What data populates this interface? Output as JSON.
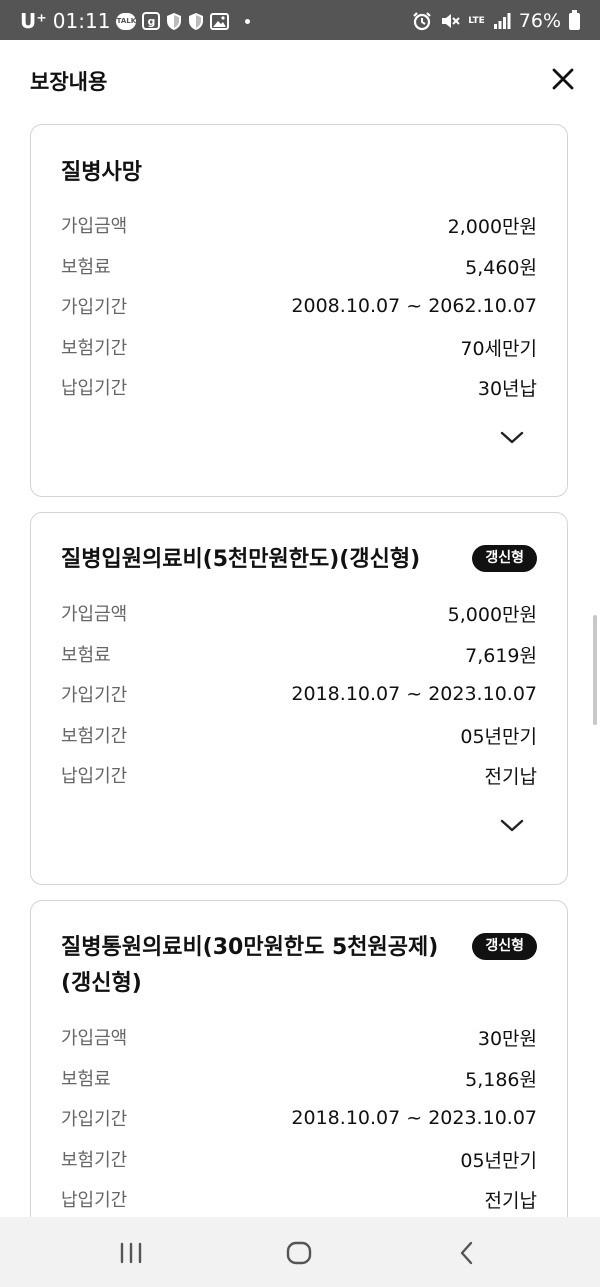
{
  "status_bar": {
    "carrier": "U⁺",
    "time": "01:11",
    "talk_icon_text": "TALK",
    "g_icon_text": "g",
    "lte": "LTE",
    "battery": "76%"
  },
  "header": {
    "title": "보장내용"
  },
  "labels": {
    "amount": "가입금액",
    "premium": "보험료",
    "join_period": "가입기간",
    "coverage_period": "보험기간",
    "payment_period": "납입기간"
  },
  "cards": [
    {
      "title": "질병사망",
      "badge": "",
      "amount": "2,000만원",
      "premium": "5,460원",
      "join_period": "2008.10.07 ~ 2062.10.07",
      "coverage_period": "70세만기",
      "payment_period": "30년납"
    },
    {
      "title": "질병입원의료비(5천만원한도)(갱신형)",
      "badge": "갱신형",
      "amount": "5,000만원",
      "premium": "7,619원",
      "join_period": "2018.10.07 ~ 2023.10.07",
      "coverage_period": "05년만기",
      "payment_period": "전기납"
    },
    {
      "title": "질병통원의료비(30만원한도 5천원공제)(갱신형)",
      "badge": "갱신형",
      "amount": "30만원",
      "premium": "5,186원",
      "join_period": "2018.10.07 ~ 2023.10.07",
      "coverage_period": "05년만기",
      "payment_period": "전기납"
    }
  ],
  "colors": {
    "status_bar": "#555555",
    "badge": "#111111",
    "card_border": "#d4d4d4",
    "nav_bar": "#f2f2f2"
  }
}
